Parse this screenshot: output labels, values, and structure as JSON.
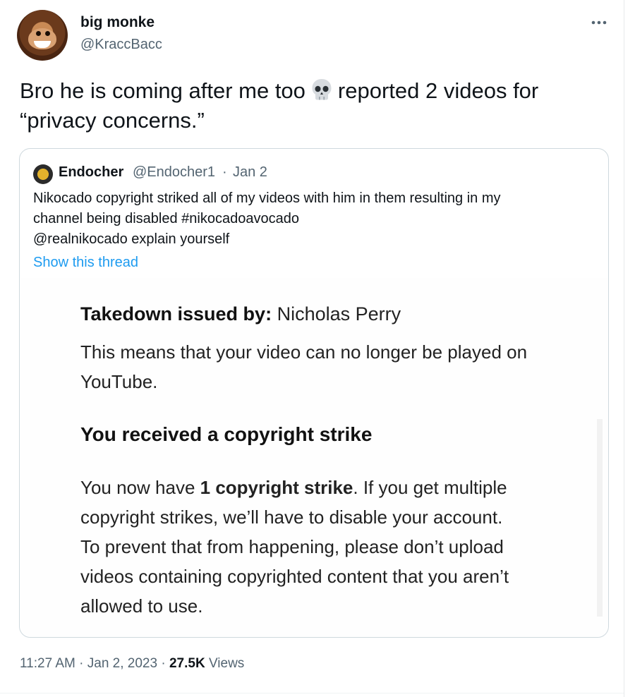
{
  "author": {
    "display_name": "big monke",
    "handle": "@KraccBacc",
    "avatar_icon": "monkey-avatar"
  },
  "tweet": {
    "text_before_emoji": "Bro he is coming after me too",
    "emoji": "skull-icon",
    "text_after_emoji": "reported 2 videos for",
    "text_line2": "“privacy concerns.”"
  },
  "quote": {
    "name": "Endocher",
    "handle": "@Endocher1",
    "separator": "·",
    "date": "Jan 2",
    "text_lines": [
      "Nikocado copyright striked all of my videos with him in them resulting in my",
      "channel being disabled #nikocadoavocado",
      "@realnikocado explain yourself"
    ],
    "show_thread": "Show this thread",
    "image": {
      "takedown_label": "Takedown issued by:",
      "takedown_value": "Nicholas Perry",
      "means_lines": [
        "This means that your video can no longer be played on",
        "YouTube."
      ],
      "heading": "You received a copyright strike",
      "body_prefix": "You now have",
      "body_bold": "1 copyright strike",
      "body_suffix": ". If you get multiple",
      "body_lines": [
        "copyright strikes, we’ll have to disable your account.",
        "To prevent that from happening, please don’t upload",
        "videos containing copyrighted content that you aren’t",
        "allowed to use."
      ]
    }
  },
  "meta": {
    "time": "11:27 AM",
    "sep1": "·",
    "date": "Jan 2, 2023",
    "sep2": "·",
    "views_count": "27.5K",
    "views_label": "Views"
  },
  "colors": {
    "link": "#1d9bf0",
    "secondary_text": "#536471",
    "border": "#cfd9de"
  }
}
